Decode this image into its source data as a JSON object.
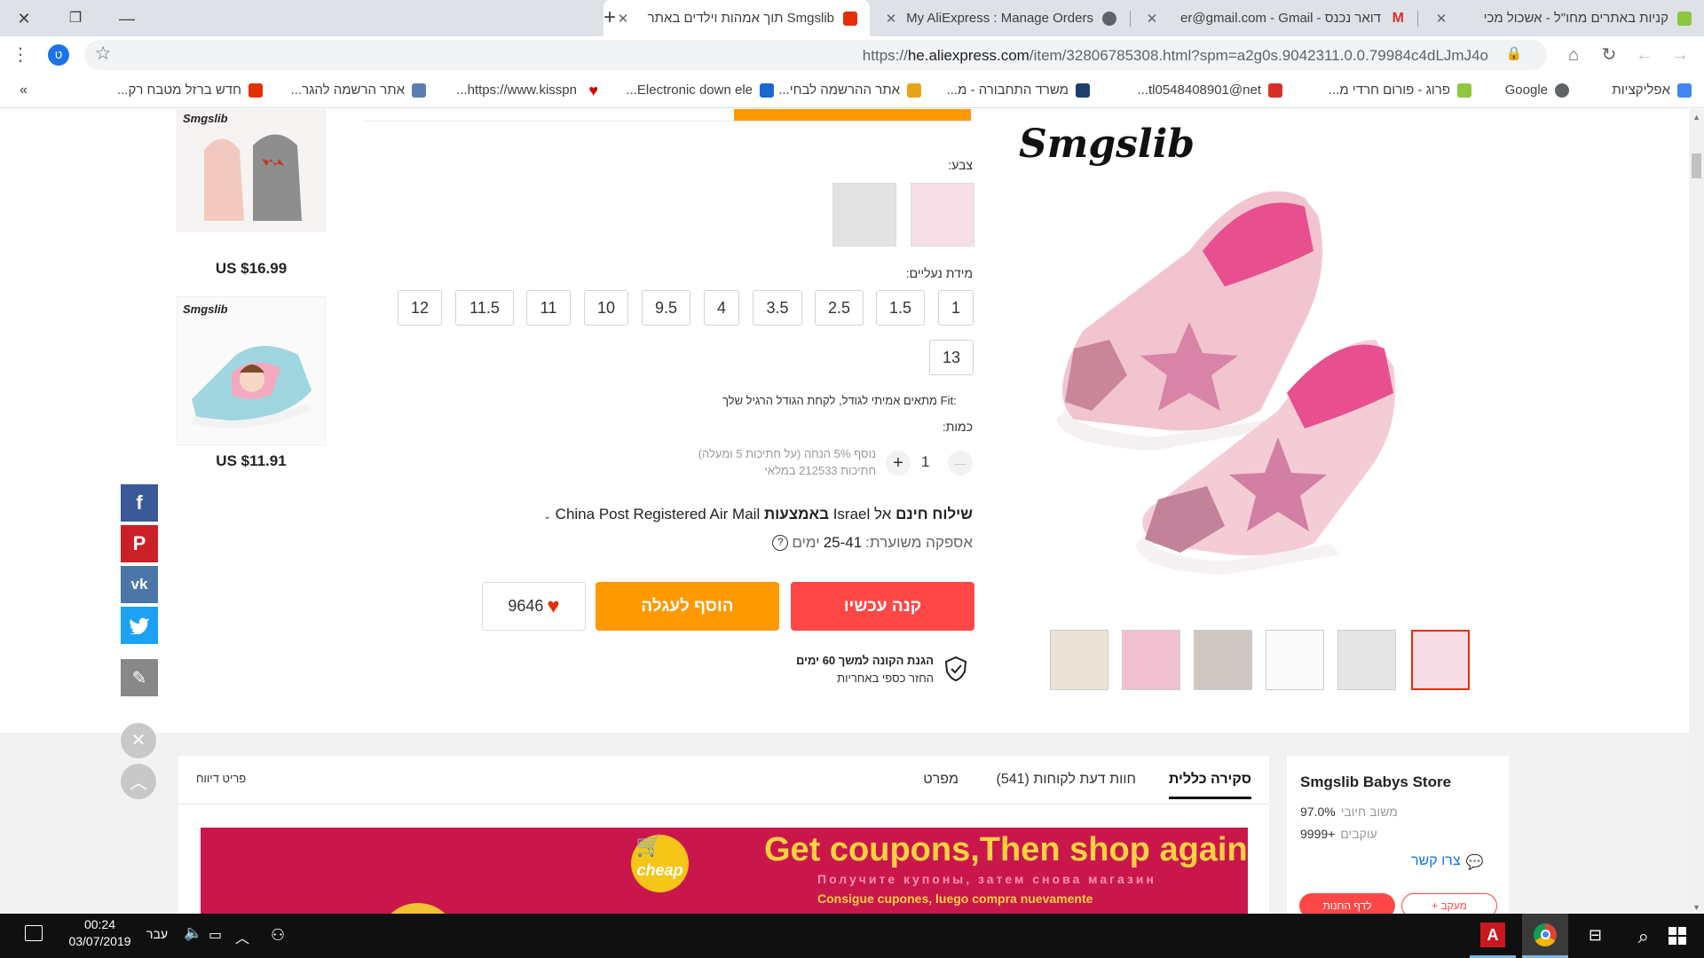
{
  "browser": {
    "tabs": [
      {
        "title": "קניות באתרים מחו\"ל - אשכול מכי",
        "close": "✕"
      },
      {
        "title": "דואר נכנס - er@gmail.com - Gmail",
        "close": "✕"
      },
      {
        "title": "My AliExpress : Manage Orders",
        "close": "✕"
      },
      {
        "title": "Smgslib תוך אמהות וילדים באתר",
        "close": "✕"
      }
    ],
    "new_tab": "+",
    "url_prefix": "https://",
    "url_host": "he.aliexpress.com",
    "url_path": "/item/32806785308.html?spm=a2g0s.9042311.0.0.79984c4dLJmJ4o",
    "profile_initial": "ט",
    "bookmarks": [
      "אפליקציות",
      "Google",
      "פרוג - פורום חרדי מ...",
      "tl0548408901@net...",
      "משרד התחבורה - מ...",
      "אתר ההרשמה לבחי...",
      "Electronic down ele...",
      "https://www.kisspn...",
      "אתר הרשמה להגר...",
      "חדש ברזל מטבח רק..."
    ],
    "bookmarks_more": "»"
  },
  "product": {
    "brand": "Smgslib",
    "color_label": "צבע:",
    "size_label": "מידת נעליים:",
    "sizes": [
      "1",
      "1.5",
      "2.5",
      "3.5",
      "4",
      "9.5",
      "10",
      "11",
      "11.5",
      "12",
      "13"
    ],
    "fit_label": "Fit:",
    "fit_text": "מתאים אמיתי לגודל, לקחת הגודל הרגיל שלך",
    "quantity_label": "כמות:",
    "quantity_value": "1",
    "qty_minus": "—",
    "qty_plus": "+",
    "discount_note": "נוסף 5% הנחה (על חתיכות 5 ומעלה)",
    "stock_note": "חתיכות 212533 במלאי",
    "shipping_free": "שילוח חינם",
    "shipping_to": "אל",
    "shipping_country": "Israel",
    "shipping_via": "באמצעות",
    "shipping_method": "China Post Registered Air Mail",
    "delivery_label": "אספקה משוערת:",
    "delivery_days": "25-41",
    "delivery_unit": "ימים",
    "buy_now": "קנה עכשיו",
    "add_to_cart": "הוסף לעגלה",
    "wishlist_count": "9646",
    "guarantee_title": "הגנת הקונה למשך 60 ימים",
    "guarantee_sub": "החזר כספי באחריות",
    "help_icon": "?"
  },
  "recommended": [
    {
      "brand": "Smgslib",
      "price": "US $16.99"
    },
    {
      "brand": "Smgslib",
      "price": "US $11.91"
    }
  ],
  "social": {
    "facebook": "f",
    "pinterest": "P",
    "vk": "vk",
    "close": "✕",
    "up": "︿"
  },
  "tabs_section": {
    "overview": "סקירה כללית",
    "reviews": "חוות דעת לקוחות (541)",
    "specs": "מפרט",
    "report": "פריט דיווח"
  },
  "store": {
    "name": "Smgslib Babys Store",
    "rating_label": "משוב חיובי",
    "rating_value": "97.0%",
    "followers_label": "עוקבים",
    "followers_value": "+9999",
    "contact": "צרו קשר",
    "follow": "+ מעקב",
    "visit": "לדף החנות"
  },
  "banner": {
    "headline": "Get coupons,Then shop again",
    "line2": "Получите купоны, затем снова магазин",
    "line3": "Consigue cupones, luego compra nuevamente",
    "badge": "cheap"
  },
  "taskbar": {
    "time": "00:24",
    "date": "03/07/2019",
    "lang": "עבר"
  },
  "colors": {
    "buy": "#ff4747",
    "cart": "#ff9900",
    "accent_red": "#e62e04",
    "taskbar": "#101010",
    "banner": "#c9174c"
  }
}
